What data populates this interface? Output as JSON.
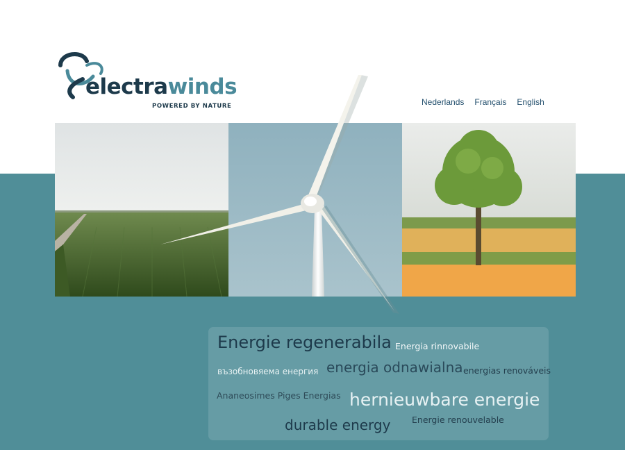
{
  "brand": {
    "wordmark_a": "electra",
    "wordmark_b": "winds",
    "tagline": "POWERED BY NATURE"
  },
  "languages": [
    "Nederlands",
    "Français",
    "English"
  ],
  "photos": [
    {
      "icon": "wheat-field-photo"
    },
    {
      "icon": "sky-photo"
    },
    {
      "icon": "tree-field-photo"
    }
  ],
  "tag_cloud": [
    "Energie regenerabila",
    "Energia rinnovabile",
    "възобновяема енергия",
    "energia odnawialna",
    "energias renováveis",
    "Ananeosimes Piges Energias",
    "hernieuwbare energie",
    "durable energy",
    "Energie renouvelable"
  ],
  "colors": {
    "teal": "#508e98",
    "navy": "#1d3a4b",
    "link": "#24506e"
  }
}
